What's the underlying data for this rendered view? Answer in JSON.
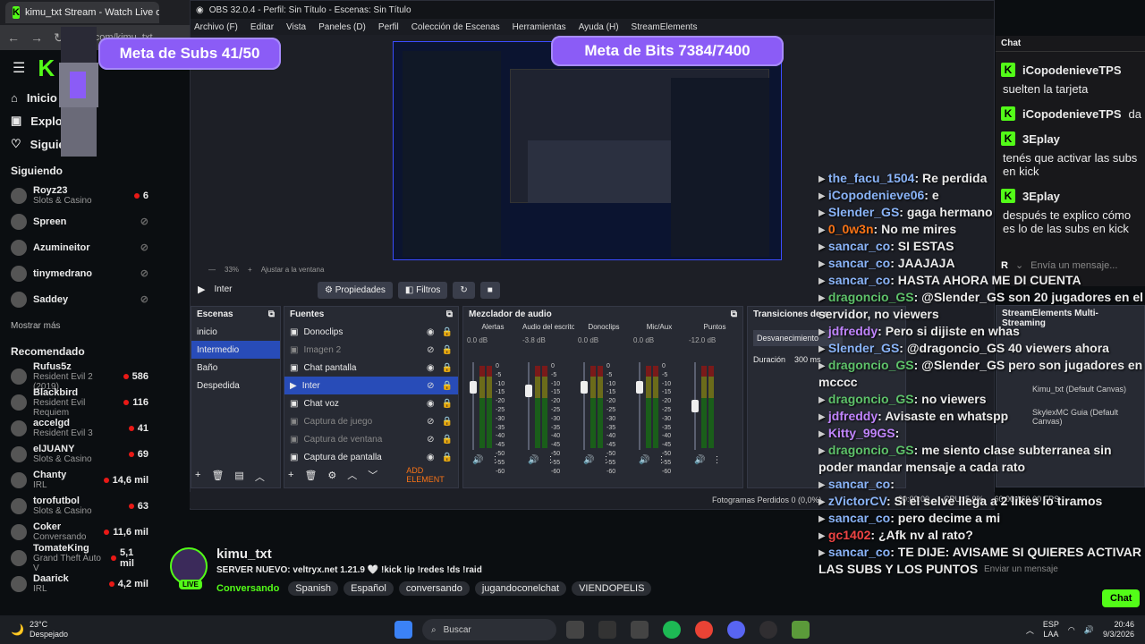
{
  "browser": {
    "tab_title": "kimu_txt Stream - Watch Live o",
    "address": "kick.com/kimu_txt"
  },
  "kick": {
    "nav": [
      {
        "label": "Inicio"
      },
      {
        "label": "Explorar"
      },
      {
        "label": "Siguiendo"
      }
    ],
    "following_title": "Siguiendo",
    "following": [
      {
        "name": "Royz23",
        "cat": "Slots & Casino",
        "viewers": "6"
      },
      {
        "name": "Spreen",
        "cat": "",
        "viewers": ""
      },
      {
        "name": "Azumineitor",
        "cat": "",
        "viewers": ""
      },
      {
        "name": "tinymedrano",
        "cat": "",
        "viewers": ""
      },
      {
        "name": "Saddey",
        "cat": "",
        "viewers": ""
      }
    ],
    "show_more": "Mostrar más",
    "recommended_title": "Recomendado",
    "recommended": [
      {
        "name": "Rufus5z",
        "cat": "Resident Evil 2 (2019)",
        "viewers": "586"
      },
      {
        "name": "Blackbird",
        "cat": "Resident Evil Requiem",
        "viewers": "116"
      },
      {
        "name": "accelgd",
        "cat": "Resident Evil 3",
        "viewers": "41"
      },
      {
        "name": "elJUANY",
        "cat": "Slots & Casino",
        "viewers": "69"
      },
      {
        "name": "Chanty",
        "cat": "IRL",
        "viewers": "14,6 mil"
      },
      {
        "name": "torofutbol",
        "cat": "Slots & Casino",
        "viewers": "63"
      },
      {
        "name": "Coker",
        "cat": "Conversando",
        "viewers": "11,6 mil"
      },
      {
        "name": "TomateKing",
        "cat": "Grand Theft Auto V",
        "viewers": "5,1 mil"
      },
      {
        "name": "Daarick",
        "cat": "IRL",
        "viewers": "4,2 mil"
      }
    ]
  },
  "overlay": {
    "subs": "Meta de Subs  41/50",
    "bits": "Meta de Bits  7384/7400"
  },
  "obs": {
    "title": "OBS 32.0.4 - Perfil: Sin Título - Escenas: Sin Título",
    "menu": [
      "Archivo (F)",
      "Editar",
      "Vista",
      "Paneles (D)",
      "Perfil",
      "Colección de Escenas",
      "Herramientas",
      "Ayuda (H)",
      "StreamElements"
    ],
    "zoom": "33%",
    "fit": "Ajustar a la ventana",
    "current_scene": "Inter",
    "props": "Propiedades",
    "filters": "Filtros",
    "scenes_title": "Escenas",
    "scenes": [
      "inicio",
      "Intermedio",
      "Baño",
      "Despedida"
    ],
    "sources_title": "Fuentes",
    "sources": [
      "Donoclips",
      "Imagen 2",
      "Chat pantalla",
      "Inter",
      "Chat voz",
      "Captura de juego",
      "Captura de ventana",
      "Captura de pantalla"
    ],
    "add_element": "ADD ELEMENT",
    "mixer_title": "Mezclador de audio",
    "channels": [
      {
        "name": "Alertas",
        "db": "0.0 dB",
        "level": 0.75
      },
      {
        "name": "Audio del escritorio",
        "db": "-3.8 dB",
        "level": 0.7
      },
      {
        "name": "Donoclips",
        "db": "0.0 dB",
        "level": 0.75
      },
      {
        "name": "Mic/Aux",
        "db": "0.0 dB",
        "level": 0.75
      },
      {
        "name": "Puntos",
        "db": "-12.0 dB",
        "level": 0.5
      }
    ],
    "ticks": [
      "0",
      "-5",
      "-10",
      "-15",
      "-20",
      "-25",
      "-30",
      "-35",
      "-40",
      "-45",
      "-50",
      "-55",
      "-60"
    ],
    "transitions_title": "Transiciones de e",
    "transition": "Desvanecimiento",
    "duration_label": "Duración",
    "duration": "300 ms",
    "se_title": "StreamElements Multi-Streaming",
    "se_items": [
      "Kimu_txt (Default Canvas)",
      "SkylexMC Guia (Default Canvas)"
    ],
    "status": {
      "dropped": "Fotogramas Perdidos 0 (0,0%)",
      "time": "00:00:00",
      "cpu": "CPU: 5.9%",
      "fps": "60.00 / 60.00 FPS"
    }
  },
  "chat": {
    "title": "Chat",
    "messages": [
      {
        "user": "iCopodenieveTPS",
        "text": "suelten la tarjeta"
      },
      {
        "user": "iCopodenieveTPS",
        "text": "da"
      },
      {
        "user": "3Eplay",
        "text": "tenés que activar las subs en kick"
      },
      {
        "user": "3Eplay",
        "text": "después te explico cómo es lo de las subs en kick"
      }
    ],
    "input_placeholder": "Envía un mensaje..."
  },
  "overlay_chat": [
    {
      "u": "the_facu_1504",
      "t": "Re perdida"
    },
    {
      "u": "iCopodenieve06",
      "t": "e"
    },
    {
      "u": "Slender_GS",
      "t": "gaga hermano"
    },
    {
      "u": "0_0w3n",
      "t": "No me mires"
    },
    {
      "u": "sancar_co",
      "t": "SI ESTAS"
    },
    {
      "u": "sancar_co",
      "t": "JAAJAJA"
    },
    {
      "u": "sancar_co",
      "t": "HASTA AHORA ME DI CUENTA"
    },
    {
      "u": "dragoncio_GS",
      "t": "@Slender_GS son 20 jugadores en el servidor, no viewers"
    },
    {
      "u": "jdfreddy",
      "t": "Pero si dijiste en whas"
    },
    {
      "u": "Slender_GS",
      "t": "@dragoncio_GS 40 viewers ahora"
    },
    {
      "u": "dragoncio_GS",
      "t": "@Slender_GS pero son jugadores en mcccc"
    },
    {
      "u": "dragoncio_GS",
      "t": "no viewers"
    },
    {
      "u": "jdfreddy",
      "t": "Avisaste en whatspp"
    },
    {
      "u": "Kitty_99GS",
      "t": ""
    },
    {
      "u": "dragoncio_GS",
      "t": "me siento clase subterranea sin poder mandar mensaje a cada rato"
    },
    {
      "u": "sancar_co",
      "t": ""
    },
    {
      "u": "zVictorCV",
      "t": "Si el selve llega a 2 likes lo tiramos"
    },
    {
      "u": "sancar_co",
      "t": "pero decime a mi"
    },
    {
      "u": "gc1402",
      "t": "¿Afk nv al rato?"
    },
    {
      "u": "sancar_co",
      "t": "TE DIJE: AVISAME SI QUIERES ACTIVAR LAS SUBS Y LOS PUNTOS"
    }
  ],
  "stream": {
    "name": "kimu_txt",
    "title": "SERVER NUEVO: veltryx.net 1.21.9 🤍 !kick !ip !redes !ds !raid",
    "live": "LIVE",
    "category": "Conversando",
    "tags": [
      "Spanish",
      "Español",
      "conversando",
      "jugandoconelchat",
      "VIENDOPELIS"
    ],
    "chat_btn": "Chat",
    "send_placeholder": "Enviar un mensaje"
  },
  "taskbar": {
    "weather_temp": "23°C",
    "weather_text": "Despejado",
    "search": "Buscar",
    "lang": "ESP",
    "lang2": "LAA",
    "time": "20:46",
    "date": "9/3/2026"
  }
}
